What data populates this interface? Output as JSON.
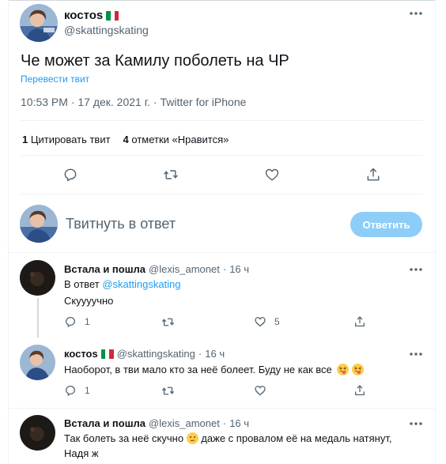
{
  "main_tweet": {
    "name": "костоs",
    "handle": "@skattingskating",
    "text": "Че может за Камилу поболеть на ЧР",
    "translate_label": "Перевести твит",
    "timestamp": "10:53 PM · 17 дек. 2021 г. · Twitter for iPhone",
    "quote_count": "1",
    "quote_label": "Цитировать твит",
    "like_count": "4",
    "like_label": "отметки «Нравится»"
  },
  "composer": {
    "placeholder": "Твитнуть в ответ",
    "reply_button": "Ответить"
  },
  "replies": [
    {
      "name": "Встала и пошла",
      "handle": "@lexis_amonet",
      "dot": "·",
      "time": "16 ч",
      "reply_to_prefix": "В ответ",
      "reply_to_handle": "@skattingskating",
      "text": "Скуууучно",
      "reply_count": "1",
      "like_count": "5"
    },
    {
      "name": "костоs",
      "handle": "@skattingskating",
      "dot": "·",
      "time": "16 ч",
      "text": "Наоборот, в тви мало кто за неё болеет. Буду не как все",
      "reply_count": "1"
    },
    {
      "name": "Встала и пошла",
      "handle": "@lexis_amonet",
      "dot": "·",
      "time": "16 ч",
      "text_line1_a": "Так болеть за неё скучно",
      "text_line1_b": "даже с провалом её на медаль натянут,",
      "text_line2": "Надя ж"
    }
  ],
  "colors": {
    "accent": "#1d9bf0",
    "reply_button_disabled": "#8ecdf8",
    "secondary_text": "#536471",
    "divider": "#eff3f4"
  },
  "icons": [
    "more-icon",
    "reply-icon",
    "retweet-icon",
    "like-icon",
    "share-icon",
    "italy-flag-icon",
    "squinting-tongue-emoji",
    "neutral-face-emoji"
  ]
}
